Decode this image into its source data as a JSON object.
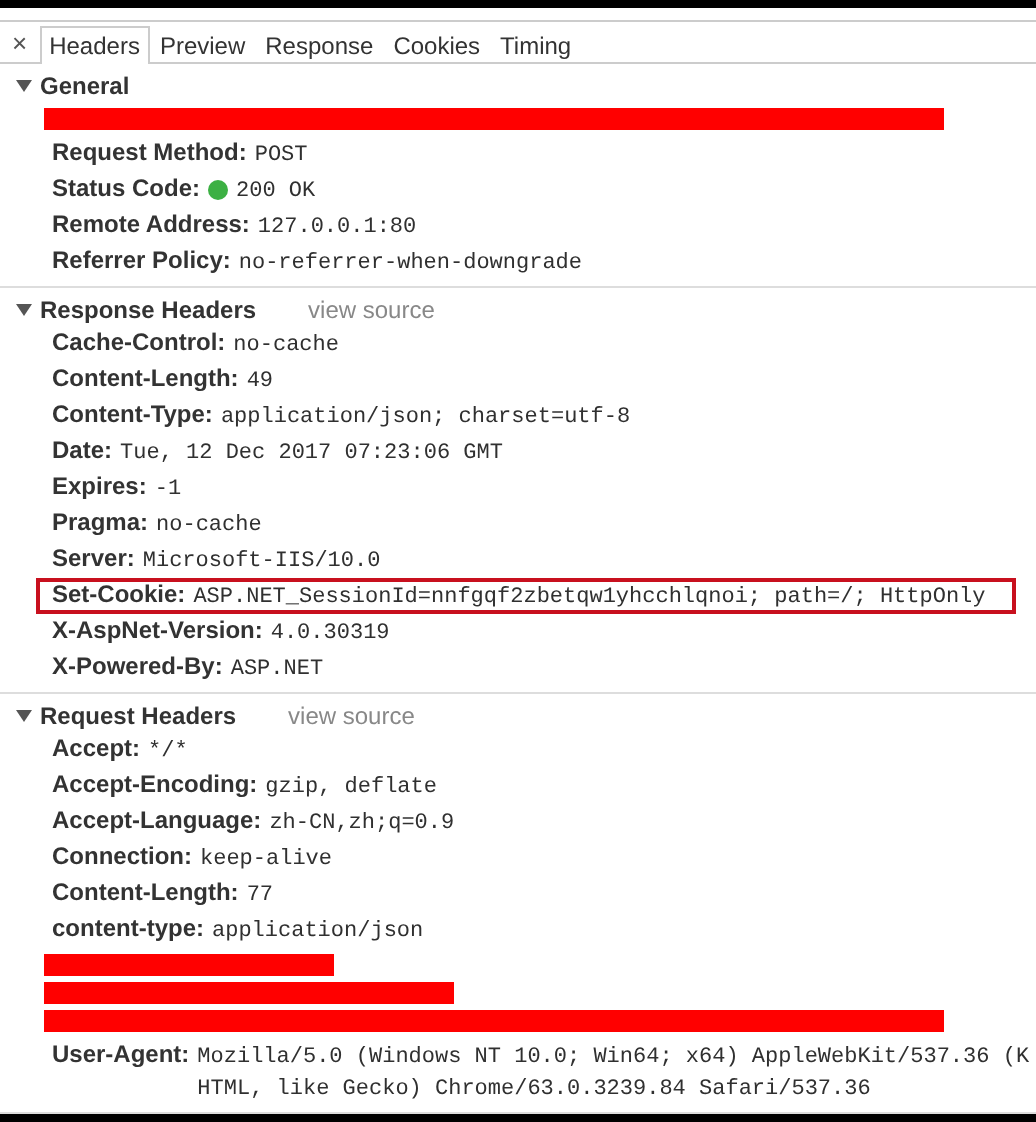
{
  "close_button": "×",
  "tabs": [
    {
      "label": "Headers",
      "selected": true
    },
    {
      "label": "Preview",
      "selected": false
    },
    {
      "label": "Response",
      "selected": false
    },
    {
      "label": "Cookies",
      "selected": false
    },
    {
      "label": "Timing",
      "selected": false
    }
  ],
  "sections": [
    {
      "title": "General",
      "expanded": true,
      "rows": [
        {
          "kind": "redacted-long"
        },
        {
          "kind": "header",
          "name": "Request Method:",
          "value": "POST",
          "highlighted": false
        },
        {
          "kind": "status",
          "name": "Status Code:",
          "value": "200 OK",
          "color": "#3cb043",
          "highlighted": false
        },
        {
          "kind": "header",
          "name": "Remote Address:",
          "value": "127.0.0.1:80",
          "highlighted": false
        },
        {
          "kind": "header",
          "name": "Referrer Policy:",
          "value": "no-referrer-when-downgrade",
          "highlighted": false
        }
      ]
    },
    {
      "title": "Response Headers",
      "expanded": true,
      "link": "view source",
      "rows": [
        {
          "kind": "header",
          "name": "Cache-Control:",
          "value": "no-cache",
          "highlighted": false
        },
        {
          "kind": "header",
          "name": "Content-Length:",
          "value": "49",
          "highlighted": false
        },
        {
          "kind": "header",
          "name": "Content-Type:",
          "value": "application/json; charset=utf-8",
          "highlighted": false
        },
        {
          "kind": "header",
          "name": "Date:",
          "value": "Tue, 12 Dec 2017 07:23:06 GMT",
          "highlighted": false
        },
        {
          "kind": "header",
          "name": "Expires:",
          "value": "-1",
          "highlighted": false
        },
        {
          "kind": "header",
          "name": "Pragma:",
          "value": "no-cache",
          "highlighted": false
        },
        {
          "kind": "header",
          "name": "Server:",
          "value": "Microsoft-IIS/10.0",
          "highlighted": false
        },
        {
          "kind": "header",
          "name": "Set-Cookie:",
          "value": "ASP.NET_SessionId=nnfgqf2zbetqw1yhcchlqnoi; path=/; HttpOnly",
          "highlighted": true
        },
        {
          "kind": "header",
          "name": "X-AspNet-Version:",
          "value": "4.0.30319",
          "highlighted": false
        },
        {
          "kind": "header",
          "name": "X-Powered-By:",
          "value": "ASP.NET",
          "highlighted": false
        }
      ]
    },
    {
      "title": "Request Headers",
      "expanded": true,
      "link": "view source",
      "rows": [
        {
          "kind": "header",
          "name": "Accept:",
          "value": "*/*",
          "highlighted": false
        },
        {
          "kind": "header",
          "name": "Accept-Encoding:",
          "value": "gzip, deflate",
          "highlighted": false
        },
        {
          "kind": "header",
          "name": "Accept-Language:",
          "value": "zh-CN,zh;q=0.9",
          "highlighted": false
        },
        {
          "kind": "header",
          "name": "Connection:",
          "value": "keep-alive",
          "highlighted": false
        },
        {
          "kind": "header",
          "name": "Content-Length:",
          "value": "77",
          "highlighted": false
        },
        {
          "kind": "header",
          "name": "content-type:",
          "value": "application/json",
          "highlighted": false
        },
        {
          "kind": "redacted-short"
        },
        {
          "kind": "redacted-medium"
        },
        {
          "kind": "redacted-long"
        },
        {
          "kind": "header",
          "name": "User-Agent:",
          "value": "Mozilla/5.0 (Windows NT 10.0; Win64; x64) AppleWebKit/537.36 (KHTML, like Gecko) Chrome/63.0.3239.84 Safari/537.36",
          "highlighted": false
        }
      ]
    }
  ]
}
